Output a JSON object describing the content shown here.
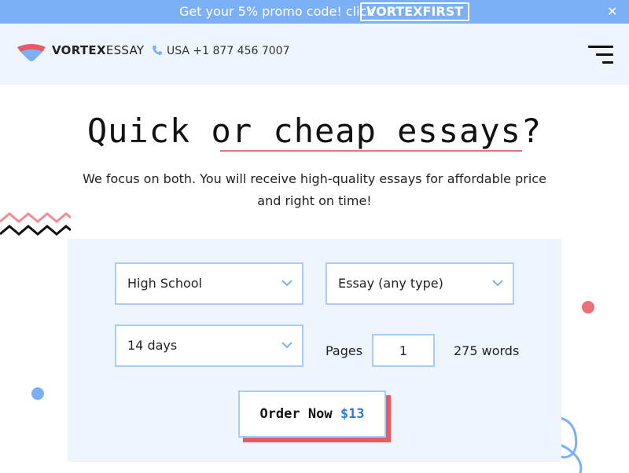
{
  "promo": {
    "text": "Get your 5% promo code! click",
    "code": "VORTEXFIRST",
    "close": "✕"
  },
  "header": {
    "logo_bold": "VORTEX",
    "logo_rest": "ESSAY",
    "phone": "USA +1 877 456 7007"
  },
  "hero": {
    "title": "Quick or cheap essays?",
    "subtitle": "We focus on both. You will receive high-quality essays for affordable price and right on time!"
  },
  "form": {
    "level": "High School",
    "type": "Essay (any type)",
    "deadline": "14 days",
    "pages_label": "Pages",
    "pages_value": "1",
    "words": "275 words",
    "order_label": "Order Now",
    "price": "$13"
  },
  "colors": {
    "accent_blue": "#7cb0f6",
    "accent_red": "#e85b64",
    "panel_bg": "#eef5fd"
  }
}
